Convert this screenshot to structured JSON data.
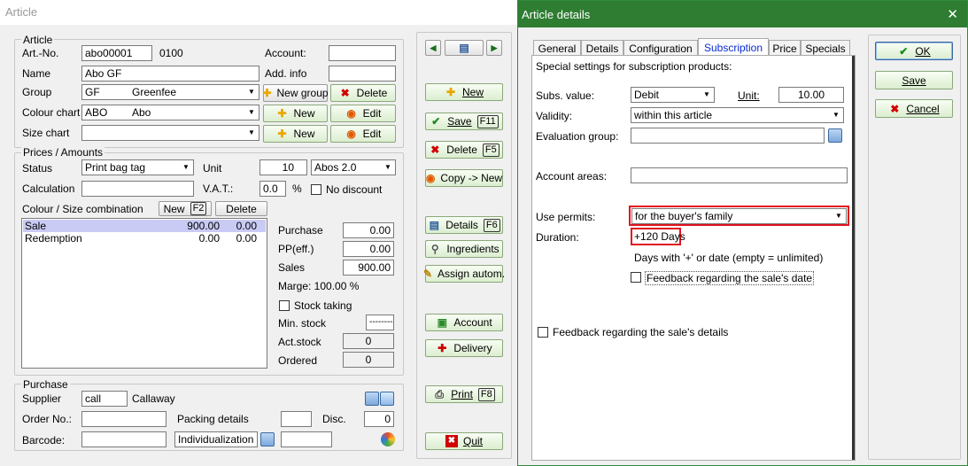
{
  "article_window": {
    "title": "Article",
    "article_group": {
      "title": "Article",
      "art_no_label": "Art.-No.",
      "art_no_value": "abo00001",
      "art_code": "0100",
      "account_label": "Account:",
      "account_value": "",
      "name_label": "Name",
      "name_value": "Abo GF",
      "add_info_label": "Add. info",
      "add_info_value": "",
      "group_label": "Group",
      "group_code": "GF",
      "group_name": "Greenfee",
      "new_group_label": "New group",
      "delete_label": "Delete",
      "colour_chart_label": "Colour chart",
      "colour_chart_code": "ABO",
      "colour_chart_name": "Abo",
      "new_label": "New",
      "edit_label": "Edit",
      "size_chart_label": "Size chart",
      "size_chart_value": ""
    },
    "prices": {
      "title": "Prices / Amounts",
      "status_label": "Status",
      "status_value": "Print bag tag",
      "unit_label": "Unit",
      "unit_qty": "10",
      "unit_value": "Abos 2.0",
      "calculation_label": "Calculation",
      "calculation_value": "",
      "vat_label": "V.A.T.:",
      "vat_value": "0.0",
      "percent": "%",
      "no_discount_label": "No discount",
      "combination_label": "Colour / Size combination",
      "new_label": "New",
      "new_key": "F2",
      "delete_label": "Delete",
      "rows": [
        {
          "name": "Sale",
          "v1": "900.00",
          "v2": "0.00"
        },
        {
          "name": "Redemption",
          "v1": "0.00",
          "v2": "0.00"
        }
      ],
      "purchase_label": "Purchase",
      "purchase_value": "0.00",
      "ppeff_label": "PP(eff.)",
      "ppeff_value": "0.00",
      "sales_label": "Sales",
      "sales_value": "900.00",
      "marge": "Marge: 100.00 %",
      "stock_taking_label": "Stock taking",
      "min_stock_label": "Min. stock",
      "min_stock_value": "--------",
      "act_stock_label": "Act.stock",
      "act_stock_value": "0",
      "ordered_label": "Ordered",
      "ordered_value": "0"
    },
    "purchase": {
      "title": "Purchase",
      "supplier_label": "Supplier",
      "supplier_code": "call",
      "supplier_name": "Callaway",
      "order_no_label": "Order No.:",
      "order_no_value": "",
      "packing_label": "Packing details",
      "packing_value": "",
      "disc_label": "Disc.",
      "disc_value": "0",
      "barcode_label": "Barcode:",
      "barcode_value": "",
      "individualization": "Individualization",
      "extra_value": ""
    },
    "side_buttons": {
      "new": "New",
      "save": "Save",
      "save_key": "F11",
      "delete": "Delete",
      "delete_key": "F5",
      "copy": "Copy -> New",
      "details": "Details",
      "details_key": "F6",
      "ingredients": "Ingredients",
      "assign": "Assign autom.",
      "account": "Account",
      "delivery": "Delivery",
      "print": "Print",
      "print_key": "F8",
      "quit": "Quit"
    }
  },
  "details_window": {
    "title": "Article details",
    "close": "✕",
    "tabs": [
      "General",
      "Details",
      "Configuration",
      "Subscription",
      "Price",
      "Specials"
    ],
    "active_tab": "Subscription",
    "intro": "Special settings for subscription products:",
    "subs_value_label": "Subs. value:",
    "subs_value": "Debit",
    "unit_label": "Unit:",
    "unit_value": "10.00",
    "validity_label": "Validity:",
    "validity_value": "within this article",
    "evaluation_label": "Evaluation group:",
    "evaluation_value": "",
    "account_areas_label": "Account areas:",
    "account_areas_value": "",
    "use_permits_label": "Use permits:",
    "use_permits_value": "for the buyer's family",
    "duration_label": "Duration:",
    "duration_value": "+120 Days",
    "duration_hint": "Days with '+' or date (empty = unlimited)",
    "feedback_date_label": "Feedback regarding the sale's date",
    "feedback_details_label": "Feedback regarding the sale's details",
    "ok": "OK",
    "save": "Save",
    "cancel": "Cancel"
  },
  "colors": {
    "highlight_red": "#e0141e",
    "dialog_border": "#2e8b3a",
    "title_bar_green": "#2e7d32",
    "selection_blue": "#c9cbf5"
  }
}
